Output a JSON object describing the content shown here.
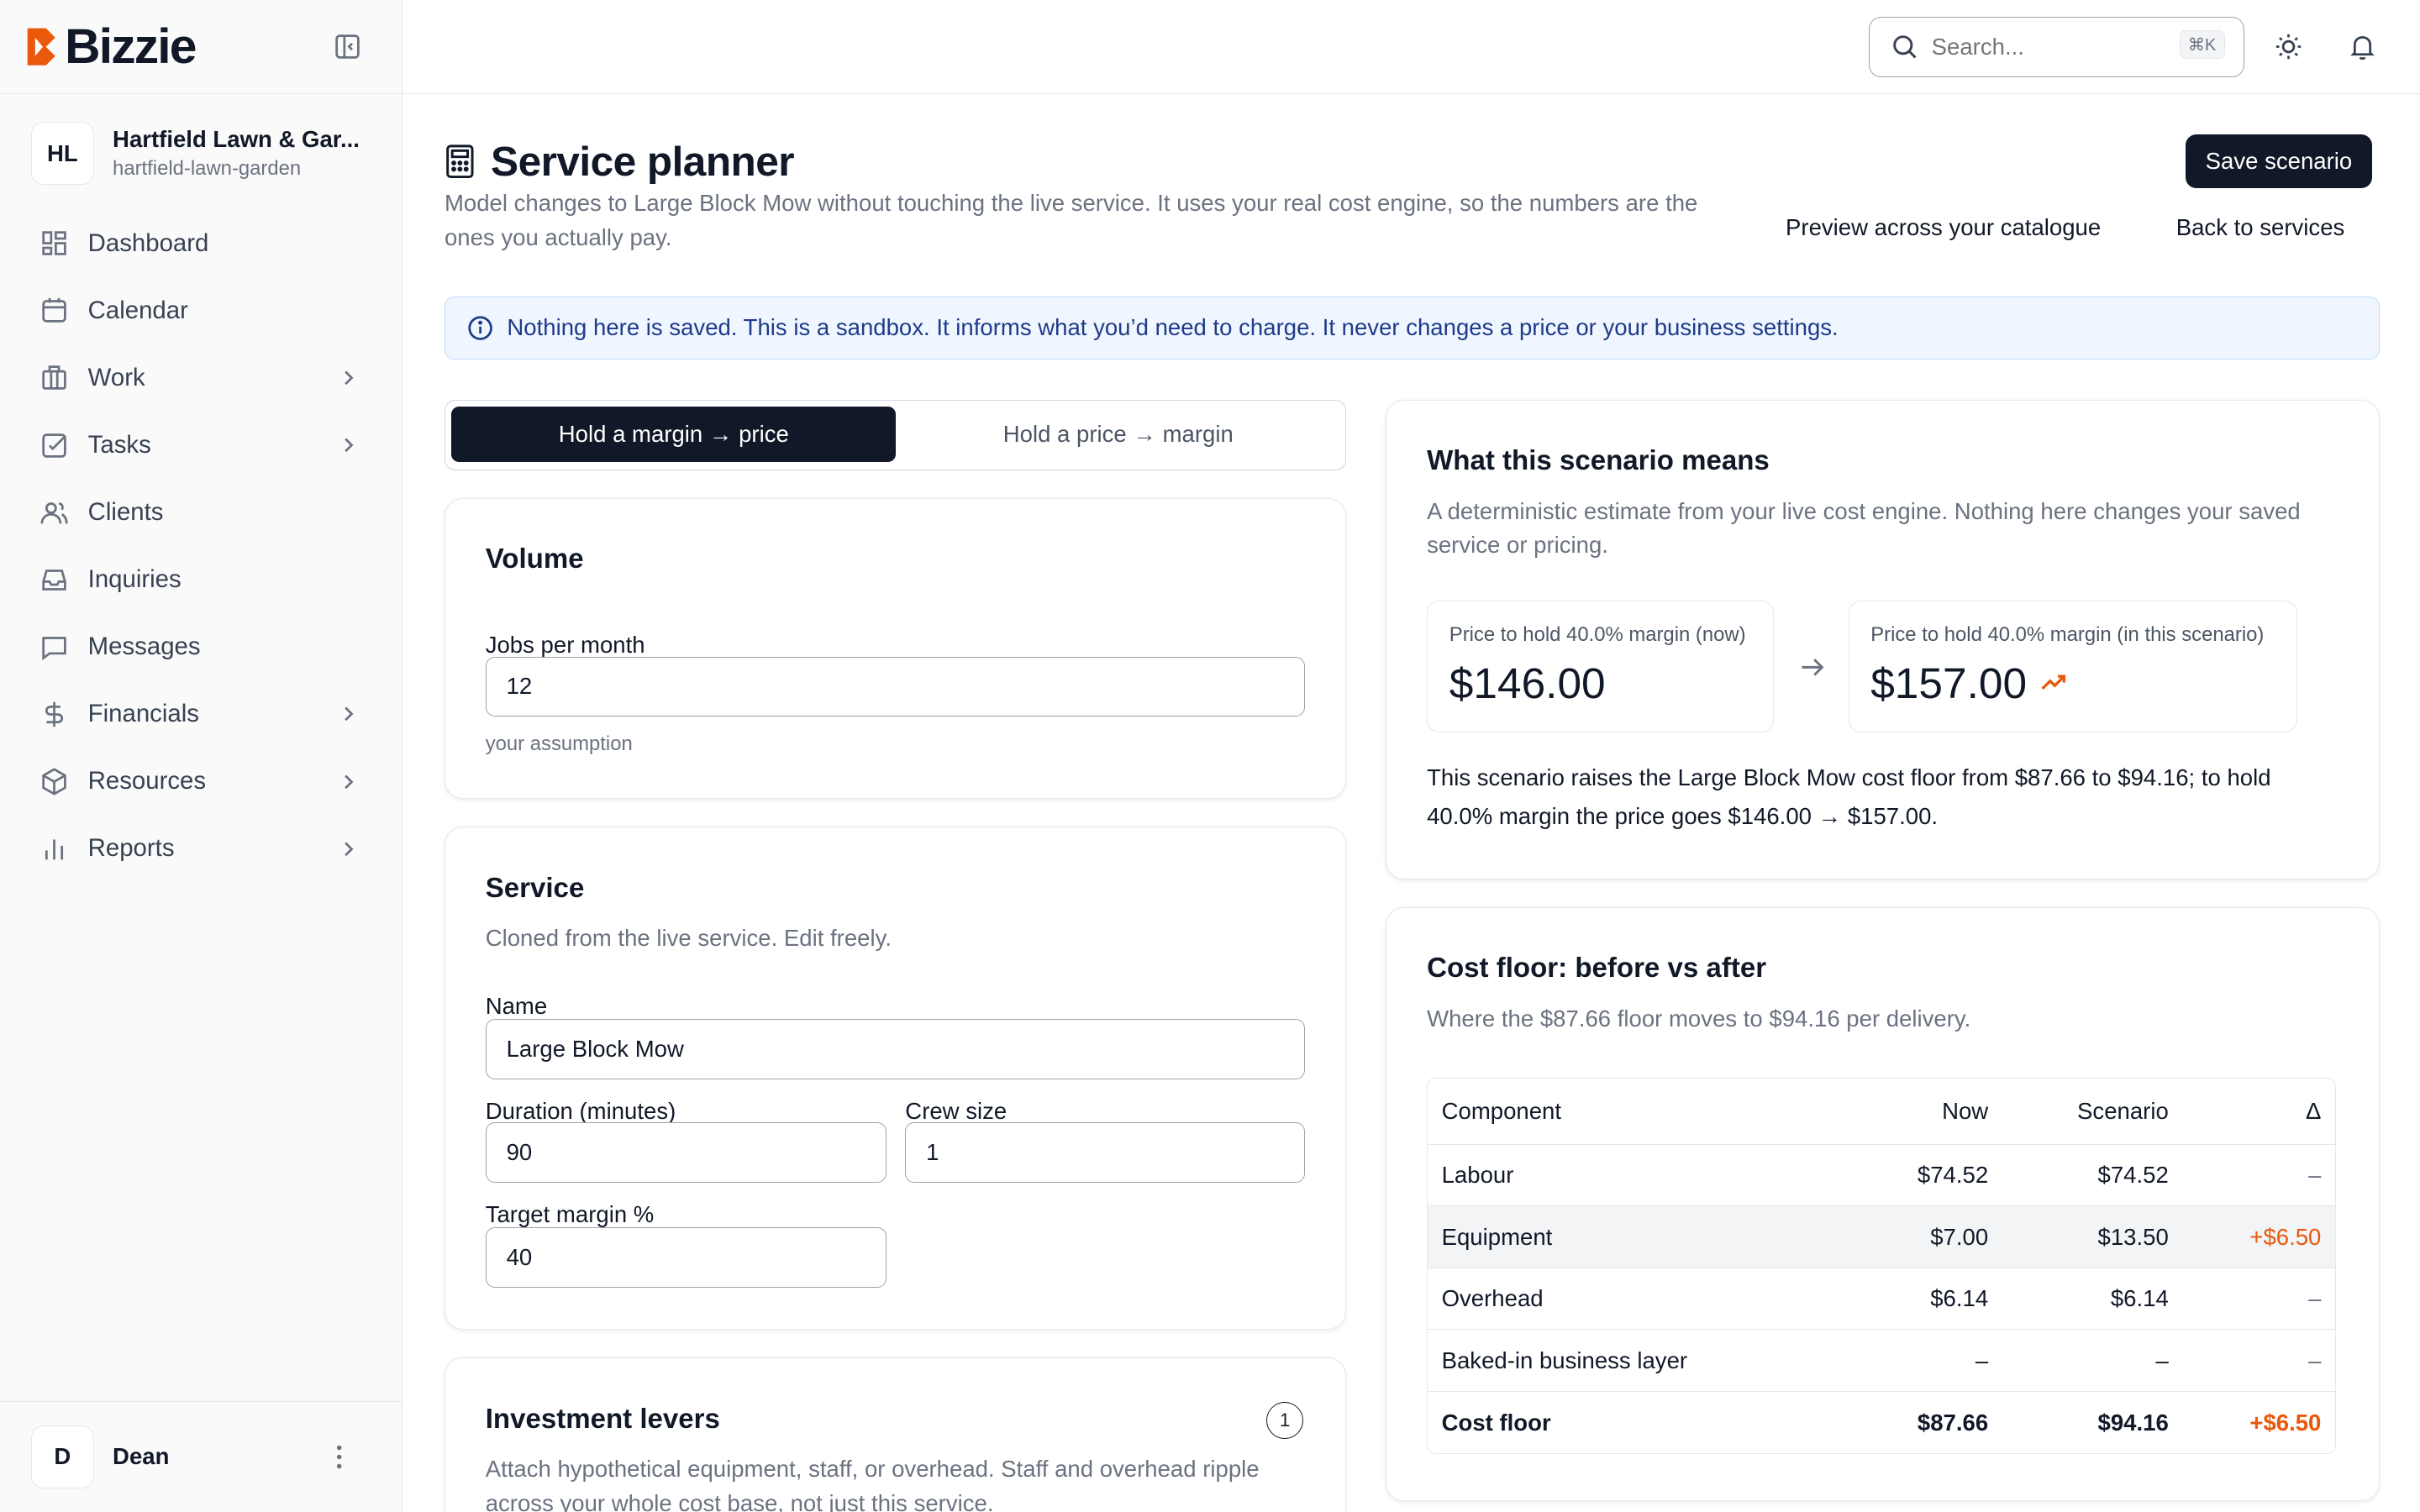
{
  "brand": {
    "name": "Bizzie",
    "accent": "#ea580c"
  },
  "org": {
    "initials": "HL",
    "name": "Hartfield Lawn & Gar...",
    "slug": "hartfield-lawn-garden"
  },
  "nav": [
    {
      "label": "Dashboard",
      "icon": "dashboard-icon",
      "chevron": false
    },
    {
      "label": "Calendar",
      "icon": "calendar-icon",
      "chevron": false
    },
    {
      "label": "Work",
      "icon": "briefcase-icon",
      "chevron": true
    },
    {
      "label": "Tasks",
      "icon": "checkbox-icon",
      "chevron": true
    },
    {
      "label": "Clients",
      "icon": "users-icon",
      "chevron": false
    },
    {
      "label": "Inquiries",
      "icon": "inbox-icon",
      "chevron": false
    },
    {
      "label": "Messages",
      "icon": "message-icon",
      "chevron": false
    },
    {
      "label": "Financials",
      "icon": "dollar-icon",
      "chevron": true
    },
    {
      "label": "Resources",
      "icon": "box-icon",
      "chevron": true
    },
    {
      "label": "Reports",
      "icon": "bar-chart-icon",
      "chevron": true
    }
  ],
  "user": {
    "initial": "D",
    "name": "Dean"
  },
  "topbar": {
    "search_placeholder": "Search...",
    "shortcut": "⌘K"
  },
  "page": {
    "title": "Service planner",
    "description": "Model changes to Large Block Mow without touching the live service. It uses your real cost engine, so the numbers are the ones you actually pay.",
    "save_label": "Save scenario",
    "preview_label": "Preview across your catalogue",
    "back_label": "Back to services",
    "notice": "Nothing here is saved. This is a sandbox. It informs what you’d need to charge. It never changes a price or your business settings."
  },
  "mode": {
    "active": "Hold a margin → price",
    "inactive": "Hold a price → margin"
  },
  "volume": {
    "title": "Volume",
    "jobs_label": "Jobs per month",
    "jobs_value": "12",
    "jobs_hint": "your assumption"
  },
  "service": {
    "title": "Service",
    "subtitle": "Cloned from the live service. Edit freely.",
    "name_label": "Name",
    "name_value": "Large Block Mow",
    "duration_label": "Duration (minutes)",
    "duration_value": "90",
    "crew_label": "Crew size",
    "crew_value": "1",
    "margin_label": "Target margin %",
    "margin_value": "40"
  },
  "levers": {
    "title": "Investment levers",
    "count": "1",
    "subtitle": "Attach hypothetical equipment, staff, or overhead. Staff and overhead ripple across your whole cost base, not just this service."
  },
  "summary": {
    "title": "What this scenario means",
    "subtitle": "A deterministic estimate from your live cost engine. Nothing here changes your saved service or pricing.",
    "now_label": "Price to hold 40.0% margin (now)",
    "now_value": "$146.00",
    "scenario_label": "Price to hold 40.0% margin (in this scenario)",
    "scenario_value": "$157.00",
    "explanation": "This scenario raises the Large Block Mow cost floor from $87.66 to $94.16; to hold 40.0% margin the price goes $146.00 → $157.00."
  },
  "cost_floor": {
    "title": "Cost floor: before vs after",
    "subtitle": "Where the $87.66 floor moves to $94.16 per delivery.",
    "columns": [
      "Component",
      "Now",
      "Scenario",
      "Δ"
    ],
    "rows": [
      {
        "component": "Labour",
        "now": "$74.52",
        "scenario": "$74.52",
        "delta": "–"
      },
      {
        "component": "Equipment",
        "now": "$7.00",
        "scenario": "$13.50",
        "delta": "+$6.50"
      },
      {
        "component": "Overhead",
        "now": "$6.14",
        "scenario": "$6.14",
        "delta": "–"
      },
      {
        "component": "Baked-in business layer",
        "now": "–",
        "scenario": "–",
        "delta": "–"
      },
      {
        "component": "Cost floor",
        "now": "$87.66",
        "scenario": "$94.16",
        "delta": "+$6.50"
      }
    ]
  }
}
